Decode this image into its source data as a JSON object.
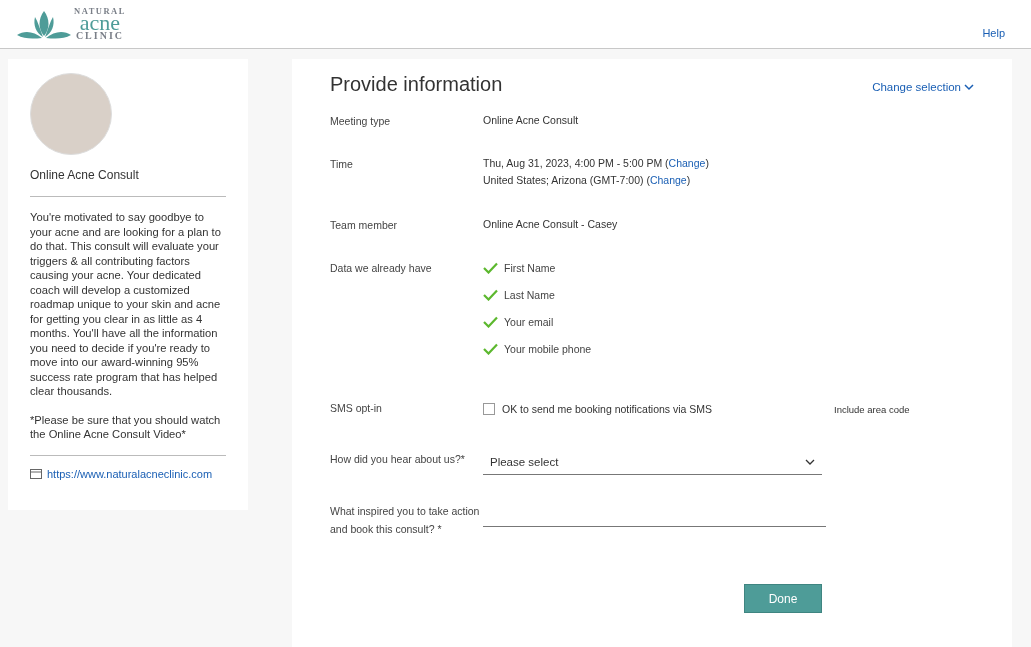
{
  "header": {
    "logo": {
      "top": "NATURAL",
      "middle": "acne",
      "bottom": "CLINIC"
    },
    "help": "Help"
  },
  "sidebar": {
    "title": "Online Acne Consult",
    "description": "You're motivated to say goodbye to your acne and are looking for a plan to do that. This consult will evaluate your triggers & all contributing factors causing your acne. Your dedicated coach will develop a customized roadmap unique to your skin and acne for getting you clear in as little as 4 months. You'll have all the information you need to decide if you're ready to move into our award-winning 95% success rate program that has helped clear thousands.",
    "note": "*Please be sure that you should watch the Online Acne Consult Video*",
    "link": "https://www.naturalacneclinic.com"
  },
  "main": {
    "title": "Provide information",
    "change_selection": "Change selection",
    "meeting_type": {
      "label": "Meeting type",
      "value": "Online Acne Consult"
    },
    "time": {
      "label": "Time",
      "lines": [
        {
          "before": "Thu, Aug 31, 2023, 4:00 PM - 5:00 PM (",
          "link": "Change",
          "after": ")"
        },
        {
          "before": "United States; Arizona (GMT-7:00) (",
          "link": "Change",
          "after": ")"
        }
      ]
    },
    "team_member": {
      "label": "Team member",
      "value": "Online Acne Consult - Casey"
    },
    "data_we_have": {
      "label": "Data we already have",
      "items": [
        "First Name",
        "Last Name",
        "Your email",
        "Your mobile phone"
      ]
    },
    "sms": {
      "label": "SMS opt-in",
      "option": "OK to send me booking notifications via SMS",
      "checked": false,
      "hint": "Include area code"
    },
    "hear_about": {
      "label": "How did you hear about us?*",
      "placeholder": "Please select"
    },
    "inspired": {
      "label": "What inspired you to take action and book this consult? *"
    },
    "done": "Done"
  }
}
